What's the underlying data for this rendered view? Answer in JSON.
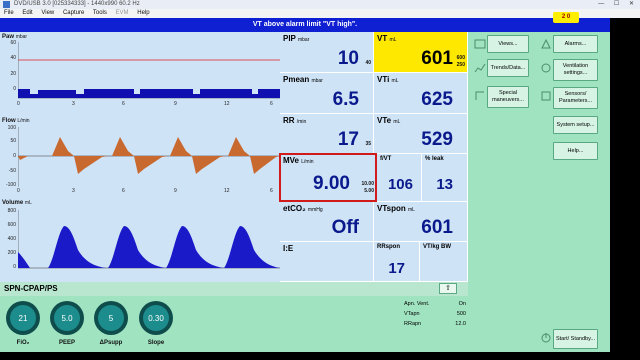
{
  "window": {
    "title": "DVD/USB 3.0 [025334333] - 1440x990 60.2 Hz",
    "controls": "— ☐ ✕"
  },
  "menu": [
    "File",
    "Edit",
    "View",
    "Capture",
    "Tools",
    "EVM",
    "Help"
  ],
  "alarm": {
    "message": "VT above alarm limit \"VT high\".",
    "silence_label": "2 0"
  },
  "waves": {
    "paw": {
      "title": "Paw",
      "unit": "mbar",
      "yticks": [
        "60",
        "40",
        "20",
        "0"
      ],
      "xticks": [
        "0",
        "3",
        "6",
        "9",
        "12",
        "6"
      ]
    },
    "flow": {
      "title": "Flow",
      "unit": "L/min",
      "yticks": [
        "100",
        "50",
        "0",
        "-50",
        "-100"
      ],
      "xticks": [
        "0",
        "3",
        "6",
        "9",
        "12",
        "6"
      ]
    },
    "volume": {
      "title": "Volume",
      "unit": "mL",
      "yticks": [
        "800",
        "600",
        "400",
        "200",
        "0"
      ],
      "xticks": [
        "0",
        "3",
        "6",
        "9",
        "12",
        "6"
      ]
    }
  },
  "params": {
    "pip": {
      "label": "PIP",
      "unit": "mbar",
      "value": "10",
      "limit": "40"
    },
    "vt": {
      "label": "VT",
      "unit": "mL",
      "value": "601",
      "limit_hi": "600",
      "limit_lo": "250"
    },
    "pmean": {
      "label": "Pmean",
      "unit": "mbar",
      "value": "6.5"
    },
    "vti": {
      "label": "VTi",
      "unit": "mL",
      "value": "625"
    },
    "rr": {
      "label": "RR",
      "unit": "/min",
      "value": "17",
      "limit": "35"
    },
    "vte": {
      "label": "VTe",
      "unit": "mL",
      "value": "529"
    },
    "mve": {
      "label": "MVe",
      "unit": "L/min",
      "value": "9.00",
      "limit_hi": "10.00",
      "limit_lo": "5.00"
    },
    "rsbi": {
      "label": "f/VT",
      "value": "106"
    },
    "leak": {
      "label": "% leak",
      "value": "13"
    },
    "etco2": {
      "label": "etCO₂",
      "unit": "mmHg",
      "value": "Off"
    },
    "vtspon": {
      "label": "VTspon",
      "unit": "mL",
      "value": "601"
    },
    "ie": {
      "label": "I:E",
      "value": ""
    },
    "rrspon": {
      "label": "RRspon",
      "value": "17"
    },
    "vtkgbw": {
      "label": "VT/kg BW",
      "value": ""
    }
  },
  "buttons": {
    "views": "Views...",
    "alarms": "Alarms...",
    "trends": "Trends/Data...",
    "ventilation": "Ventilation settings...",
    "special": "Special maneuvers...",
    "sensors": "Sensors/ Parameters...",
    "system": "System setup...",
    "help": "Help...",
    "standby": "Start/ Standby..."
  },
  "mode": {
    "name": "SPN-CPAP/PS",
    "up_icon": "⇧"
  },
  "settings": [
    {
      "value": "21",
      "label": "FiO₂"
    },
    {
      "value": "5.0",
      "label": "PEEP"
    },
    {
      "value": "5",
      "label": "ΔPsupp"
    },
    {
      "value": "0.30",
      "label": "Slope"
    }
  ],
  "apnea": {
    "vent": {
      "label": "Apn. Vent.",
      "value": "On"
    },
    "vtapn": {
      "label": "VTapn",
      "value": "500"
    },
    "rrapn": {
      "label": "RRapn",
      "value": "12.0"
    }
  },
  "colors": {
    "value_blue": "#0a1a8c",
    "alarm_yellow": "#ffe800",
    "banner_blue": "#0f1fd2",
    "flow_fill": "#c8692f",
    "volume_fill": "#1a1ac8",
    "paw_fill": "#1010b0"
  }
}
